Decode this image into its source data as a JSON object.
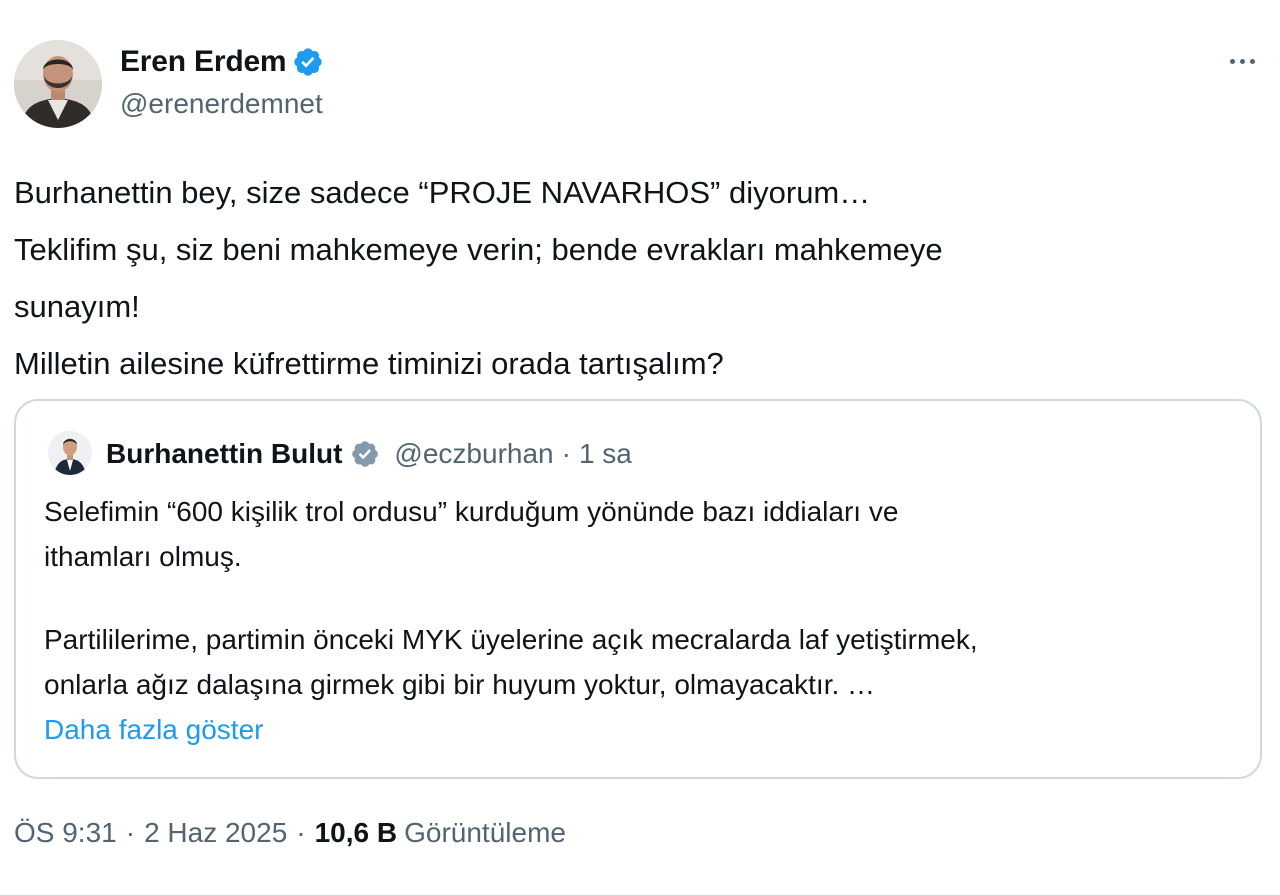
{
  "author": {
    "name": "Eren Erdem",
    "handle": "@erenerdemnet",
    "verified": true,
    "verified_badge_color": "#1d9bf0"
  },
  "more_icon": "more-horizontal-icon",
  "tweet": {
    "lines": [
      "Burhanettin bey, size sadece “PROJE NAVARHOS” diyorum…",
      "Teklifim şu, siz beni mahkemeye verin; bende evrakları mahkemeye",
      "sunayım!",
      "Milletin ailesine küfrettirme timinizi orada tartışalım?"
    ]
  },
  "quote": {
    "author_name": "Burhanettin Bulut",
    "verified": true,
    "verified_badge_color": "#829aab",
    "handle": "@eczburhan",
    "separator": "·",
    "time": "1 sa",
    "paragraph1": [
      "Selefimin “600 kişilik trol ordusu” kurduğum yönünde bazı iddiaları ve",
      "ithamları olmuş."
    ],
    "paragraph2": [
      "Partililerime, partimin önceki MYK üyelerine açık mecralarda laf yetiştirmek,",
      "onlarla ağız dalaşına girmek gibi bir huyum yoktur, olmayacaktır. …"
    ],
    "show_more_label": "Daha fazla göster"
  },
  "meta": {
    "time": "ÖS 9:31",
    "separator": "·",
    "date": "2 Haz 2025",
    "views_count": "10,6 B",
    "views_label": "Görüntüleme"
  },
  "colors": {
    "text_primary": "#0f1419",
    "text_secondary": "#536471",
    "link": "#1d9bf0",
    "border": "#cfd9de"
  }
}
